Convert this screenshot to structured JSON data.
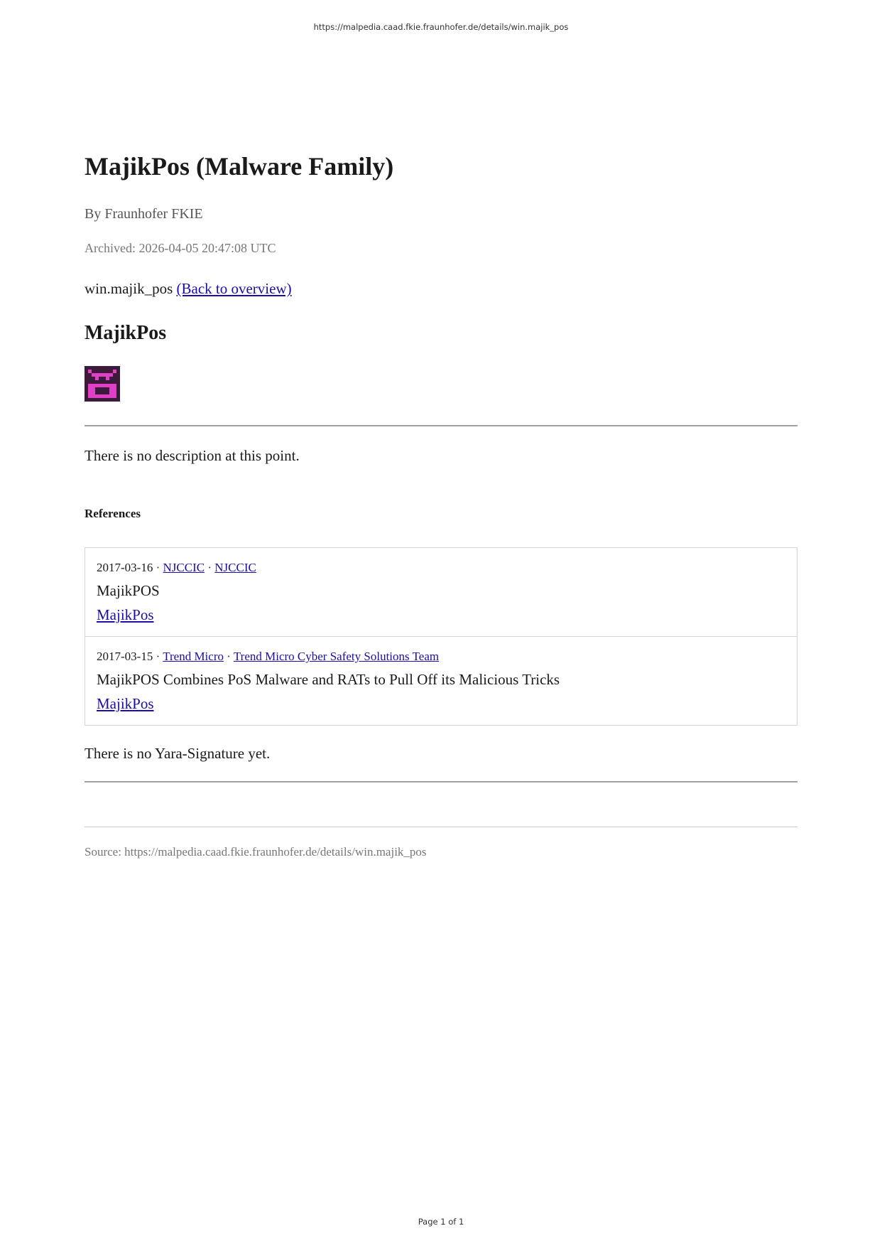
{
  "print_header": {
    "url": "https://malpedia.caad.fkie.fraunhofer.de/details/win.majik_pos"
  },
  "document": {
    "title": "MajikPos (Malware Family)",
    "byline": "By Fraunhofer FKIE",
    "archived": "Archived: 2026-04-05 20:47:08 UTC",
    "identifier": "win.majik_pos",
    "back_link": "(Back to overview)",
    "family_name": "MajikPos",
    "icon": "pixel-face-icon",
    "description": "There is no description at this point.",
    "references_heading": "References",
    "references": [
      {
        "date": "2017-03-16",
        "org": "NJCCIC",
        "author": "NJCCIC",
        "title": "MajikPOS",
        "tag": "MajikPos"
      },
      {
        "date": "2017-03-15",
        "org": "Trend Micro",
        "author": "Trend Micro Cyber Safety Solutions Team",
        "title": "MajikPOS Combines PoS Malware and RATs to Pull Off its Malicious Tricks",
        "tag": "MajikPos"
      }
    ],
    "yara": "There is no Yara-Signature yet.",
    "source": "Source: https://malpedia.caad.fkie.fraunhofer.de/details/win.majik_pos"
  },
  "print_footer": {
    "page": "Page 1 of 1"
  },
  "colors": {
    "link": "#1a0dab",
    "icon_background": "#3d1a3a",
    "icon_foreground": "#e040c8"
  }
}
